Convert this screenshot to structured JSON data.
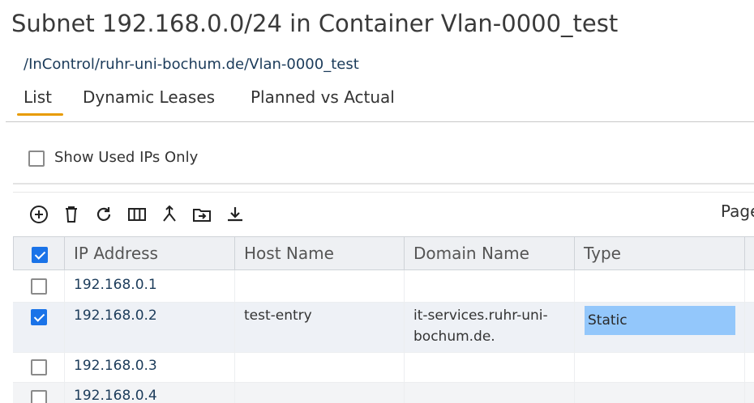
{
  "page": {
    "title": "Subnet 192.168.0.0/24 in Container Vlan-0000_test",
    "breadcrumb": "/InControl/ruhr-uni-bochum.de/Vlan-0000_test"
  },
  "tabs": [
    {
      "label": "List",
      "active": true
    },
    {
      "label": "Dynamic Leases",
      "active": false
    },
    {
      "label": "Planned vs Actual",
      "active": false
    }
  ],
  "filter": {
    "show_used_label": "Show Used IPs Only",
    "checked": false
  },
  "toolbar": {
    "icons": [
      "add-icon",
      "delete-icon",
      "refresh-icon",
      "columns-icon",
      "merge-icon",
      "move-to-folder-icon",
      "download-icon"
    ],
    "pager_label": "Page"
  },
  "grid": {
    "columns": [
      "IP Address",
      "Host Name",
      "Domain Name",
      "Type"
    ],
    "select_all_checked": true,
    "rows": [
      {
        "ip": "192.168.0.1",
        "host": "",
        "domain": "",
        "type": "",
        "checked": false
      },
      {
        "ip": "192.168.0.2",
        "host": "test-entry",
        "domain": "it-services.ruhr-uni-bochum.de.",
        "type": "Static",
        "checked": true
      },
      {
        "ip": "192.168.0.3",
        "host": "",
        "domain": "",
        "type": "",
        "checked": false
      },
      {
        "ip": "192.168.0.4",
        "host": "",
        "domain": "",
        "type": "",
        "checked": false
      }
    ]
  },
  "colors": {
    "accent": "#e89b00",
    "checkbox": "#1a73e8",
    "type_static": "#93c7fb"
  }
}
